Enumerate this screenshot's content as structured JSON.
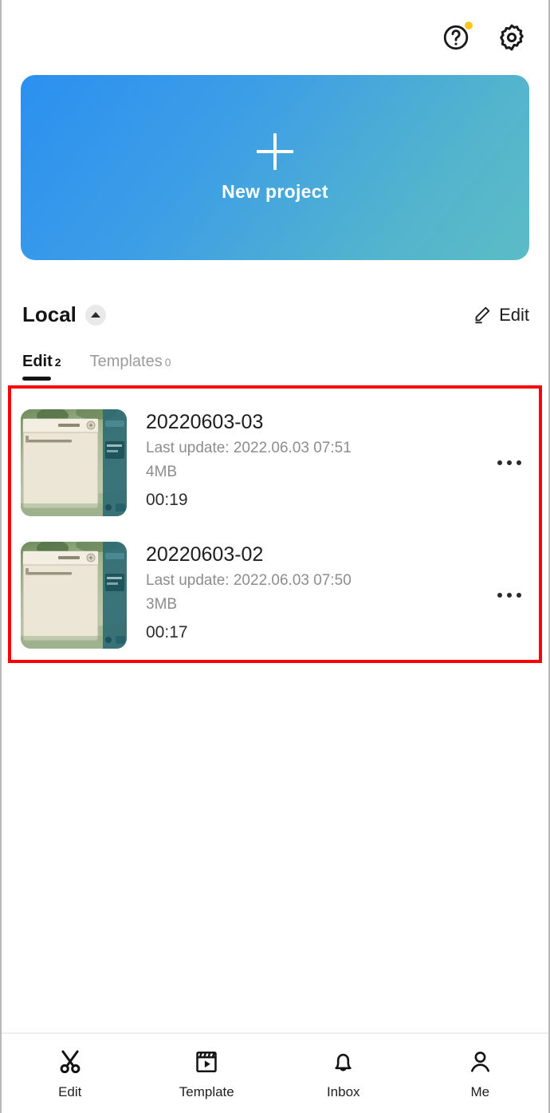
{
  "theme": {
    "card_gradient_from": "#2b90f0",
    "card_gradient_to": "#5bbcc6",
    "notification_dot": "#fcc521",
    "highlight_border": "#fb0007",
    "icon_color": "#1a1a1a",
    "muted_text": "#8d8d8d"
  },
  "header": {
    "help_icon": "question-circle-icon",
    "help_badge": "notification-dot",
    "settings_icon": "gear-icon"
  },
  "new_project": {
    "icon": "plus-icon",
    "label": "New project"
  },
  "section": {
    "title": "Local",
    "collapse_icon": "chevron-up-icon",
    "edit_icon": "pencil-icon",
    "edit_label": "Edit"
  },
  "tabs": [
    {
      "label": "Edit",
      "count": "2",
      "active": true
    },
    {
      "label": "Templates",
      "count": "0",
      "active": false
    }
  ],
  "projects": [
    {
      "title": "20220603-03",
      "last_update": "Last update: 2022.06.03 07:51",
      "size": "4MB",
      "duration": "00:19",
      "thumbnail": "game-screenshot-thumbnail",
      "more_icon": "more-horizontal-icon"
    },
    {
      "title": "20220603-02",
      "last_update": "Last update: 2022.06.03 07:50",
      "size": "3MB",
      "duration": "00:17",
      "thumbnail": "game-screenshot-thumbnail",
      "more_icon": "more-horizontal-icon"
    }
  ],
  "bottom_nav": [
    {
      "label": "Edit",
      "icon": "scissors-icon",
      "active": true
    },
    {
      "label": "Template",
      "icon": "clapperboard-icon",
      "active": false
    },
    {
      "label": "Inbox",
      "icon": "bell-icon",
      "active": false
    },
    {
      "label": "Me",
      "icon": "person-icon",
      "active": false
    }
  ]
}
